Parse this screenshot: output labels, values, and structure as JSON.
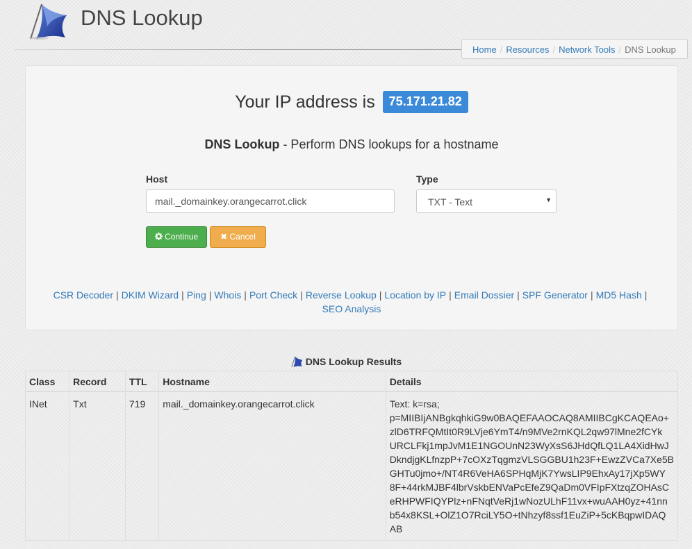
{
  "site": {
    "title": "DNS Lookup"
  },
  "breadcrumb": [
    {
      "label": "Home",
      "link": true
    },
    {
      "label": "Resources",
      "link": true
    },
    {
      "label": "Network Tools",
      "link": true
    },
    {
      "label": "DNS Lookup",
      "link": false
    }
  ],
  "ip": {
    "prefix": "Your IP address is",
    "address": "75.171.21.82"
  },
  "form": {
    "subtitle_bold": "DNS Lookup",
    "subtitle_rest": " - Perform DNS lookups for a hostname",
    "host_label": "Host",
    "host_value": "mail._domainkey.orangecarrot.click",
    "type_label": "Type",
    "type_value": "TXT - Text",
    "continue_label": "Continue",
    "cancel_label": "Cancel"
  },
  "tools": [
    "CSR Decoder",
    "DKIM Wizard",
    "Ping",
    "Whois",
    "Port Check",
    "Reverse Lookup",
    "Location by IP",
    "Email Dossier",
    "SPF Generator",
    "MD5 Hash",
    "SEO Analysis"
  ],
  "results": {
    "title": "DNS Lookup Results",
    "columns": [
      "Class",
      "Record",
      "TTL",
      "Hostname",
      "Details"
    ],
    "rows": [
      {
        "class": "INet",
        "record": "Txt",
        "ttl": "719",
        "hostname": "mail._domainkey.orangecarrot.click",
        "details_lines": [
          "Text: k=rsa;",
          "p=MIIBIjANBgkqhkiG9w0BAQEFAAOCAQ8AMIIBCgKCAQEAo+",
          "zlD6TRFQMtIt0R9LVje6YmT4/n9MVe2rnKQL2qw97lMne2fCYk",
          "URCLFkj1mpJvM1E1NGOUnN23WyXsS6JHdQfLQ1LA4XidHwJ",
          "DkndjgKLfnzpP+7cOXzTqgmzVLSGGBU1h23F+EwzZVCa7Xe5B",
          "GHTu0jmo+/NT4R6VeHA6SPHqMjK7YwsLIP9EhxAy17jXp5WY",
          "8F+44rkMJBF4lbrVskbENVaPcEfeZ9QaDm0VFIpFXtzqZOHAsC",
          "eRHPWFIQYPlz+nFNqtVeRj1wNozULhF11vx+wuAAH0yz+41nn",
          "b54x8KSL+OlZ1O7RciLY5O+tNhzyf8ssf1EuZiP+5cKBqpwIDAQ",
          "AB"
        ]
      }
    ]
  },
  "colors": {
    "ip_badge": "#3b8ad9",
    "continue": "#4cae4c",
    "cancel": "#f0ad4e",
    "link": "#337ab7"
  }
}
